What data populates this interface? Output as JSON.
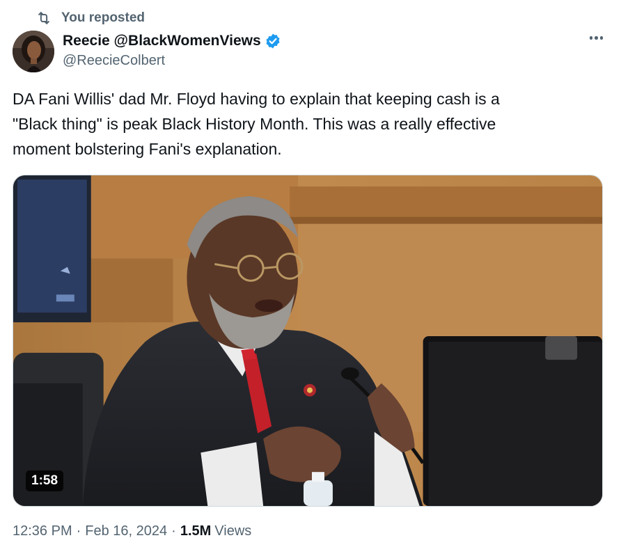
{
  "repost": {
    "label": "You reposted"
  },
  "author": {
    "name": "Reecie @BlackWomenViews",
    "handle": "@ReecieColbert",
    "verified": true
  },
  "tweet": {
    "lines": [
      "DA Fani Willis' dad Mr. Floyd having to explain that keeping cash is a",
      "\"Black thing\" is peak Black History Month. This was a really effective",
      "moment bolstering Fani's explanation."
    ]
  },
  "media": {
    "duration": "1:58"
  },
  "meta": {
    "time": "12:36 PM",
    "date": "Feb 16, 2024",
    "views_count": "1.5M",
    "views_label": "Views"
  },
  "colors": {
    "accent": "#1d9bf0",
    "secondary_text": "#536471",
    "primary_text": "#0f1419"
  },
  "icons": {
    "repost": "repost-icon",
    "verified": "verified-badge-icon",
    "more": "more-options-icon"
  }
}
